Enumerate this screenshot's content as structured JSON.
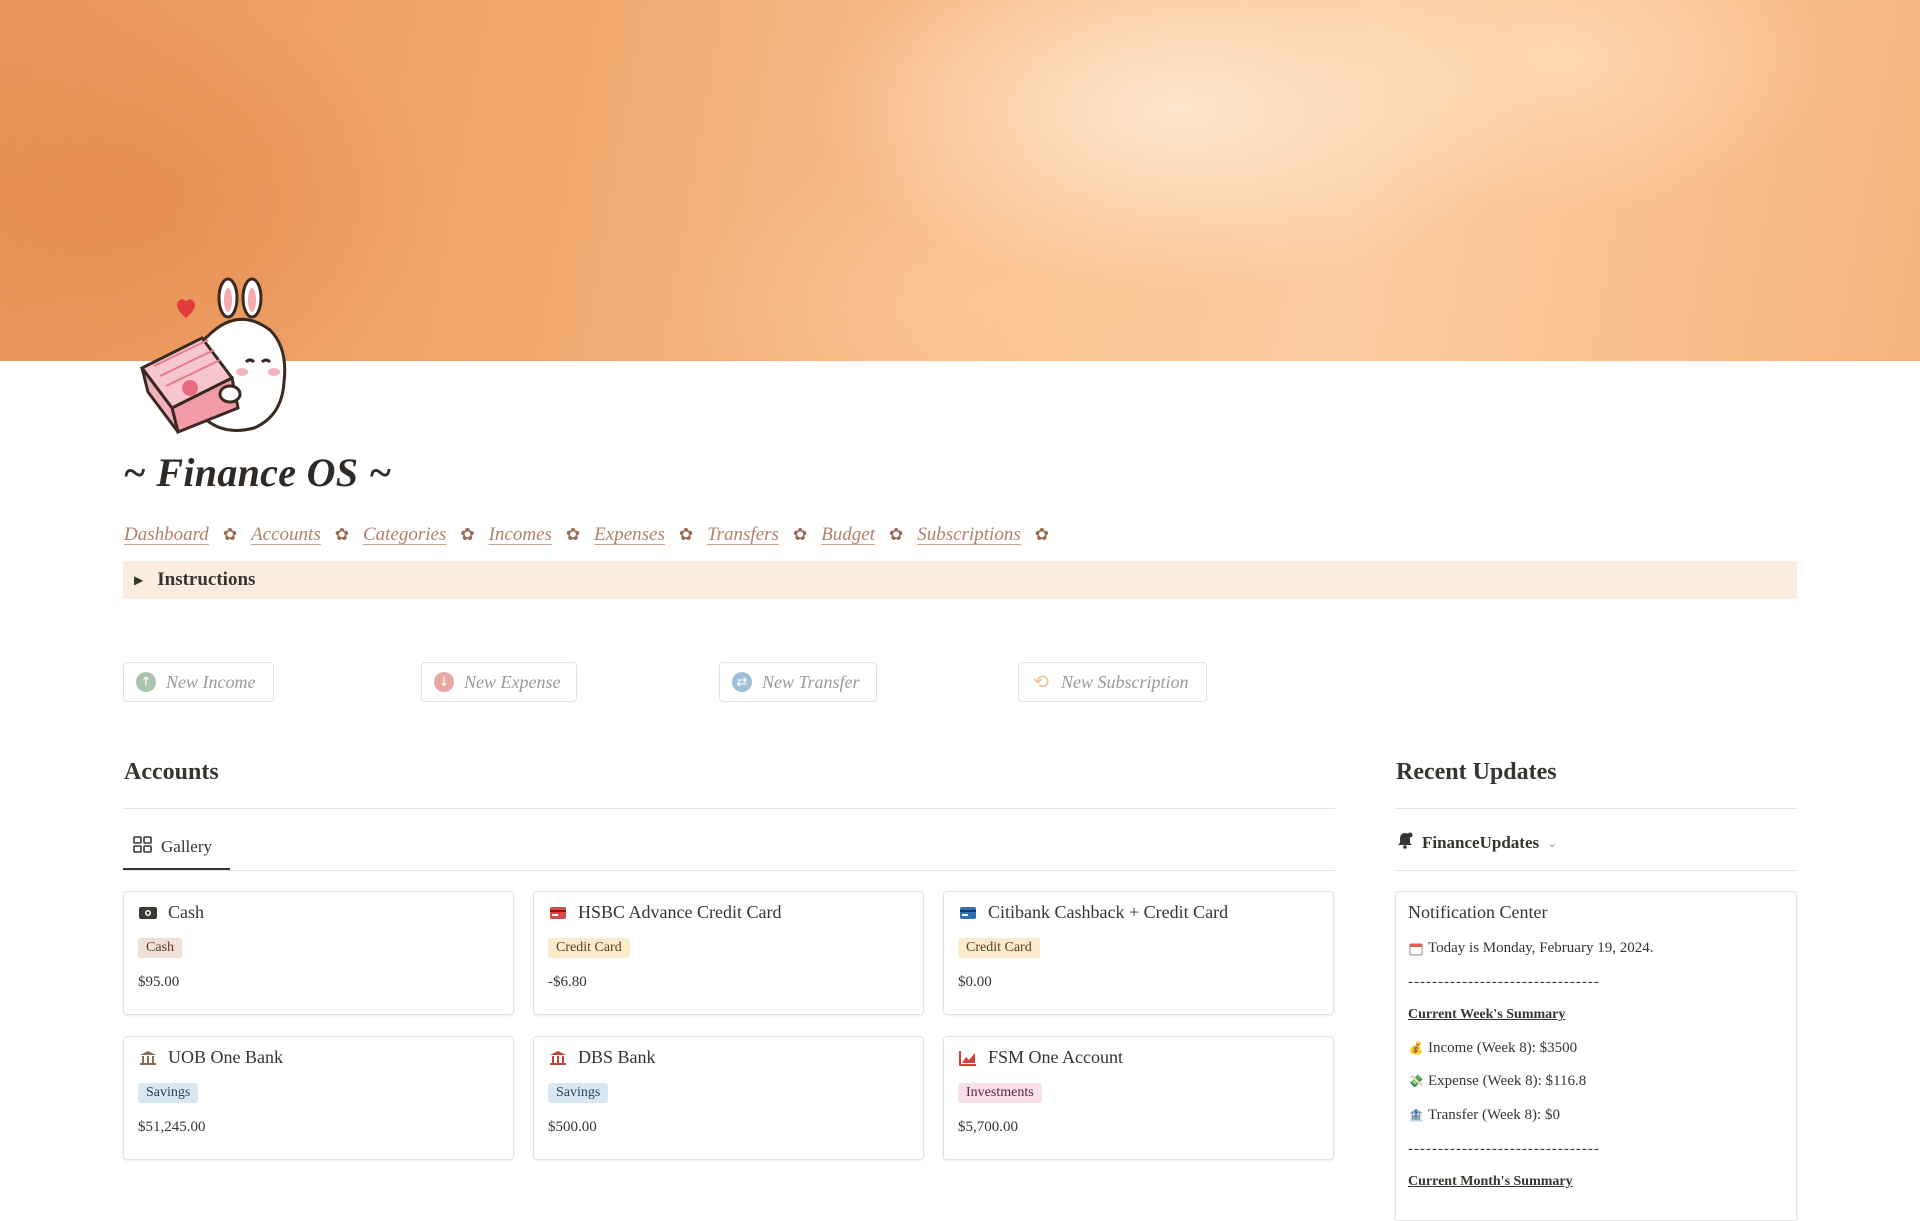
{
  "page": {
    "title": "~ Finance OS ~",
    "icon": "bunny-with-money-box-icon"
  },
  "nav": {
    "items": [
      "Dashboard",
      "Accounts",
      "Categories",
      "Incomes",
      "Expenses",
      "Transfers",
      "Budget",
      "Subscriptions"
    ],
    "separator": "✿"
  },
  "toggle": {
    "label": "Instructions",
    "arrow": "▶"
  },
  "buttons": [
    {
      "label": "New Income",
      "icon": "arrow-up-circle-icon",
      "color": "#a8c4ad"
    },
    {
      "label": "New Expense",
      "icon": "arrow-down-circle-icon",
      "color": "#e8a6a3"
    },
    {
      "label": "New Transfer",
      "icon": "transfer-circle-icon",
      "color": "#9fbfd8"
    },
    {
      "label": "New Subscription",
      "icon": "repeat-icon",
      "color": "#f2c08f"
    }
  ],
  "accounts": {
    "title": "Accounts",
    "view_tab": "Gallery",
    "cards": [
      {
        "name": "Cash",
        "icon": "cash-icon",
        "tag": "Cash",
        "tag_type": "cash",
        "amount": "$95.00"
      },
      {
        "name": "HSBC Advance Credit Card",
        "icon": "credit-card-red-icon",
        "tag": "Credit Card",
        "tag_type": "credit",
        "amount": "-$6.80"
      },
      {
        "name": "Citibank Cashback + Credit Card",
        "icon": "credit-card-blue-icon",
        "tag": "Credit Card",
        "tag_type": "credit",
        "amount": "$0.00"
      },
      {
        "name": "UOB One Bank",
        "icon": "bank-icon",
        "tag": "Savings",
        "tag_type": "savings",
        "amount": "$51,245.00"
      },
      {
        "name": "DBS Bank",
        "icon": "bank-red-icon",
        "tag": "Savings",
        "tag_type": "savings",
        "amount": "$500.00"
      },
      {
        "name": "FSM One Account",
        "icon": "chart-up-icon",
        "tag": "Investments",
        "tag_type": "invest",
        "amount": "$5,700.00"
      }
    ]
  },
  "recent": {
    "title": "Recent Updates",
    "db_name": "FinanceUpdates",
    "card_title": "Notification Center",
    "today": "Today is Monday, February 19, 2024.",
    "divider": "--------------------------------",
    "week_heading": "Current Week's Summary",
    "week_income": "Income (Week 8): $3500",
    "week_expense": "Expense (Week 8): $116.8",
    "week_transfer": "Transfer (Week 8): $0",
    "month_heading": "Current Month's Summary"
  },
  "colors": {
    "nav_link": "#b0826a",
    "toggle_bg": "#fbecdf",
    "cover_start": "#e9955c",
    "cover_end": "#fbcca1"
  }
}
